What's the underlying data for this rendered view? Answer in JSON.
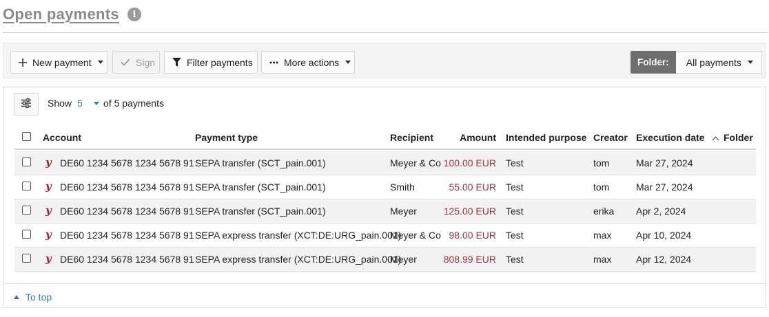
{
  "header": {
    "title": "Open payments",
    "info_icon": "info-icon"
  },
  "toolbar": {
    "new_payment": "New payment",
    "sign": "Sign",
    "filter": "Filter payments",
    "more_actions": "More actions",
    "folder_label": "Folder:",
    "folder_value": "All payments"
  },
  "list_controls": {
    "show_label": "Show",
    "show_count": "5",
    "of_total": "of 5 payments"
  },
  "table": {
    "columns": {
      "account": "Account",
      "payment_type": "Payment type",
      "recipient": "Recipient",
      "amount": "Amount",
      "purpose": "Intended purpose",
      "creator": "Creator",
      "execution_date": "Execution date",
      "folder": "Folder"
    },
    "sort": {
      "column": "execution_date",
      "direction": "ascending"
    },
    "rows": [
      {
        "account": "DE60 1234 5678 1234 5678 91",
        "payment_type": "SEPA transfer (SCT_pain.001)",
        "recipient": "Meyer & Co",
        "amount": "100.00 EUR",
        "purpose": "Test",
        "creator": "tom",
        "execution_date": "Mar 27, 2024",
        "folder": ""
      },
      {
        "account": "DE60 1234 5678 1234 5678 91",
        "payment_type": "SEPA transfer (SCT_pain.001)",
        "recipient": "Smith",
        "amount": "55.00 EUR",
        "purpose": "Test",
        "creator": "tom",
        "execution_date": "Mar 27, 2024",
        "folder": ""
      },
      {
        "account": "DE60 1234 5678 1234 5678 91",
        "payment_type": "SEPA transfer (SCT_pain.001)",
        "recipient": "Meyer",
        "amount": "125.00 EUR",
        "purpose": "Test",
        "creator": "erika",
        "execution_date": "Apr 2, 2024",
        "folder": ""
      },
      {
        "account": "DE60 1234 5678 1234 5678 91",
        "payment_type": "SEPA express transfer (XCT:DE:URG_pain.001)",
        "recipient": "Meyer & Co",
        "amount": "98.00 EUR",
        "purpose": "Test",
        "creator": "max",
        "execution_date": "Apr 10, 2024",
        "folder": ""
      },
      {
        "account": "DE60 1234 5678 1234 5678 91",
        "payment_type": "SEPA express transfer (XCT:DE:URG_pain.001)",
        "recipient": "Meyer",
        "amount": "808.99 EUR",
        "purpose": "Test",
        "creator": "max",
        "execution_date": "Apr 12, 2024",
        "folder": ""
      }
    ]
  },
  "footer": {
    "to_top": "To top"
  },
  "colors": {
    "amount": "#a0323a",
    "link": "#3a77b5",
    "account_icon": "#b5172a",
    "folder_label_bg": "#6e6e6e"
  }
}
